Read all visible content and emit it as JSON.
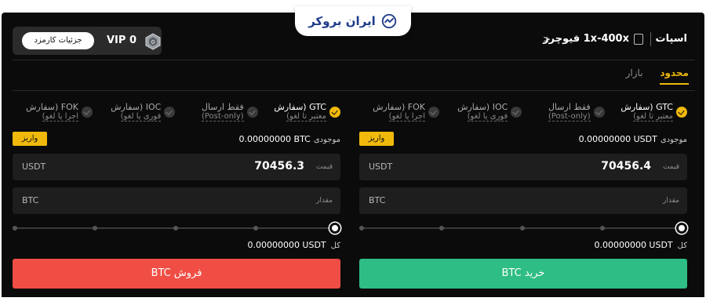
{
  "logo": {
    "text": "ایران بروکر"
  },
  "header": {
    "title": "اسپات",
    "pair": "1x-400x فیوچرز",
    "vip_label": "VIP 0",
    "fee_button": "جزئیات کارمزد"
  },
  "tabs": [
    {
      "label": "محدود",
      "active": true
    },
    {
      "label": "بازار",
      "active": false
    }
  ],
  "buy": {
    "options": [
      {
        "line1": "GTC (سفارش",
        "line2": "معتبر تا لغو)",
        "checked": true
      },
      {
        "line1": "فقط ارسال",
        "line2": "(Post-only)",
        "checked": false
      },
      {
        "line1": "IOC (سفارش",
        "line2": "فوری یا لغو)",
        "checked": false
      },
      {
        "line1": "FOK (سفارش",
        "line2": "اجرا یا لغو)",
        "checked": false
      }
    ],
    "balance_label": "موجودی",
    "balance_value": "0.00000000 USDT",
    "deposit": "واریز",
    "price_label": "قیمت",
    "price_value": "70456.4",
    "price_currency": "USDT",
    "amount_label": "مقدار",
    "amount_currency": "BTC",
    "slider_percent": 100,
    "total_label": "کل",
    "total_value": "0.00000000 USDT",
    "action": "خرید BTC"
  },
  "sell": {
    "options": [
      {
        "line1": "GTC (سفارش",
        "line2": "معتبر تا لغو)",
        "checked": true
      },
      {
        "line1": "فقط ارسال",
        "line2": "(Post-only)",
        "checked": false
      },
      {
        "line1": "IOC (سفارش",
        "line2": "فوری یا لغو)",
        "checked": false
      },
      {
        "line1": "FOK (سفارش",
        "line2": "اجرا یا لغو)",
        "checked": false
      }
    ],
    "balance_label": "موجودی",
    "balance_value": "0.00000000 BTC",
    "deposit": "واریز",
    "price_label": "قیمت",
    "price_value": "70456.3",
    "price_currency": "USDT",
    "amount_label": "مقدار",
    "amount_currency": "BTC",
    "slider_percent": 100,
    "total_label": "کل",
    "total_value": "0.00000000 USDT",
    "action": "فروش BTC"
  },
  "colors": {
    "accent": "#f0b90b",
    "buy": "#2ebd85",
    "sell": "#f04e45",
    "background": "#0b0b0b"
  }
}
